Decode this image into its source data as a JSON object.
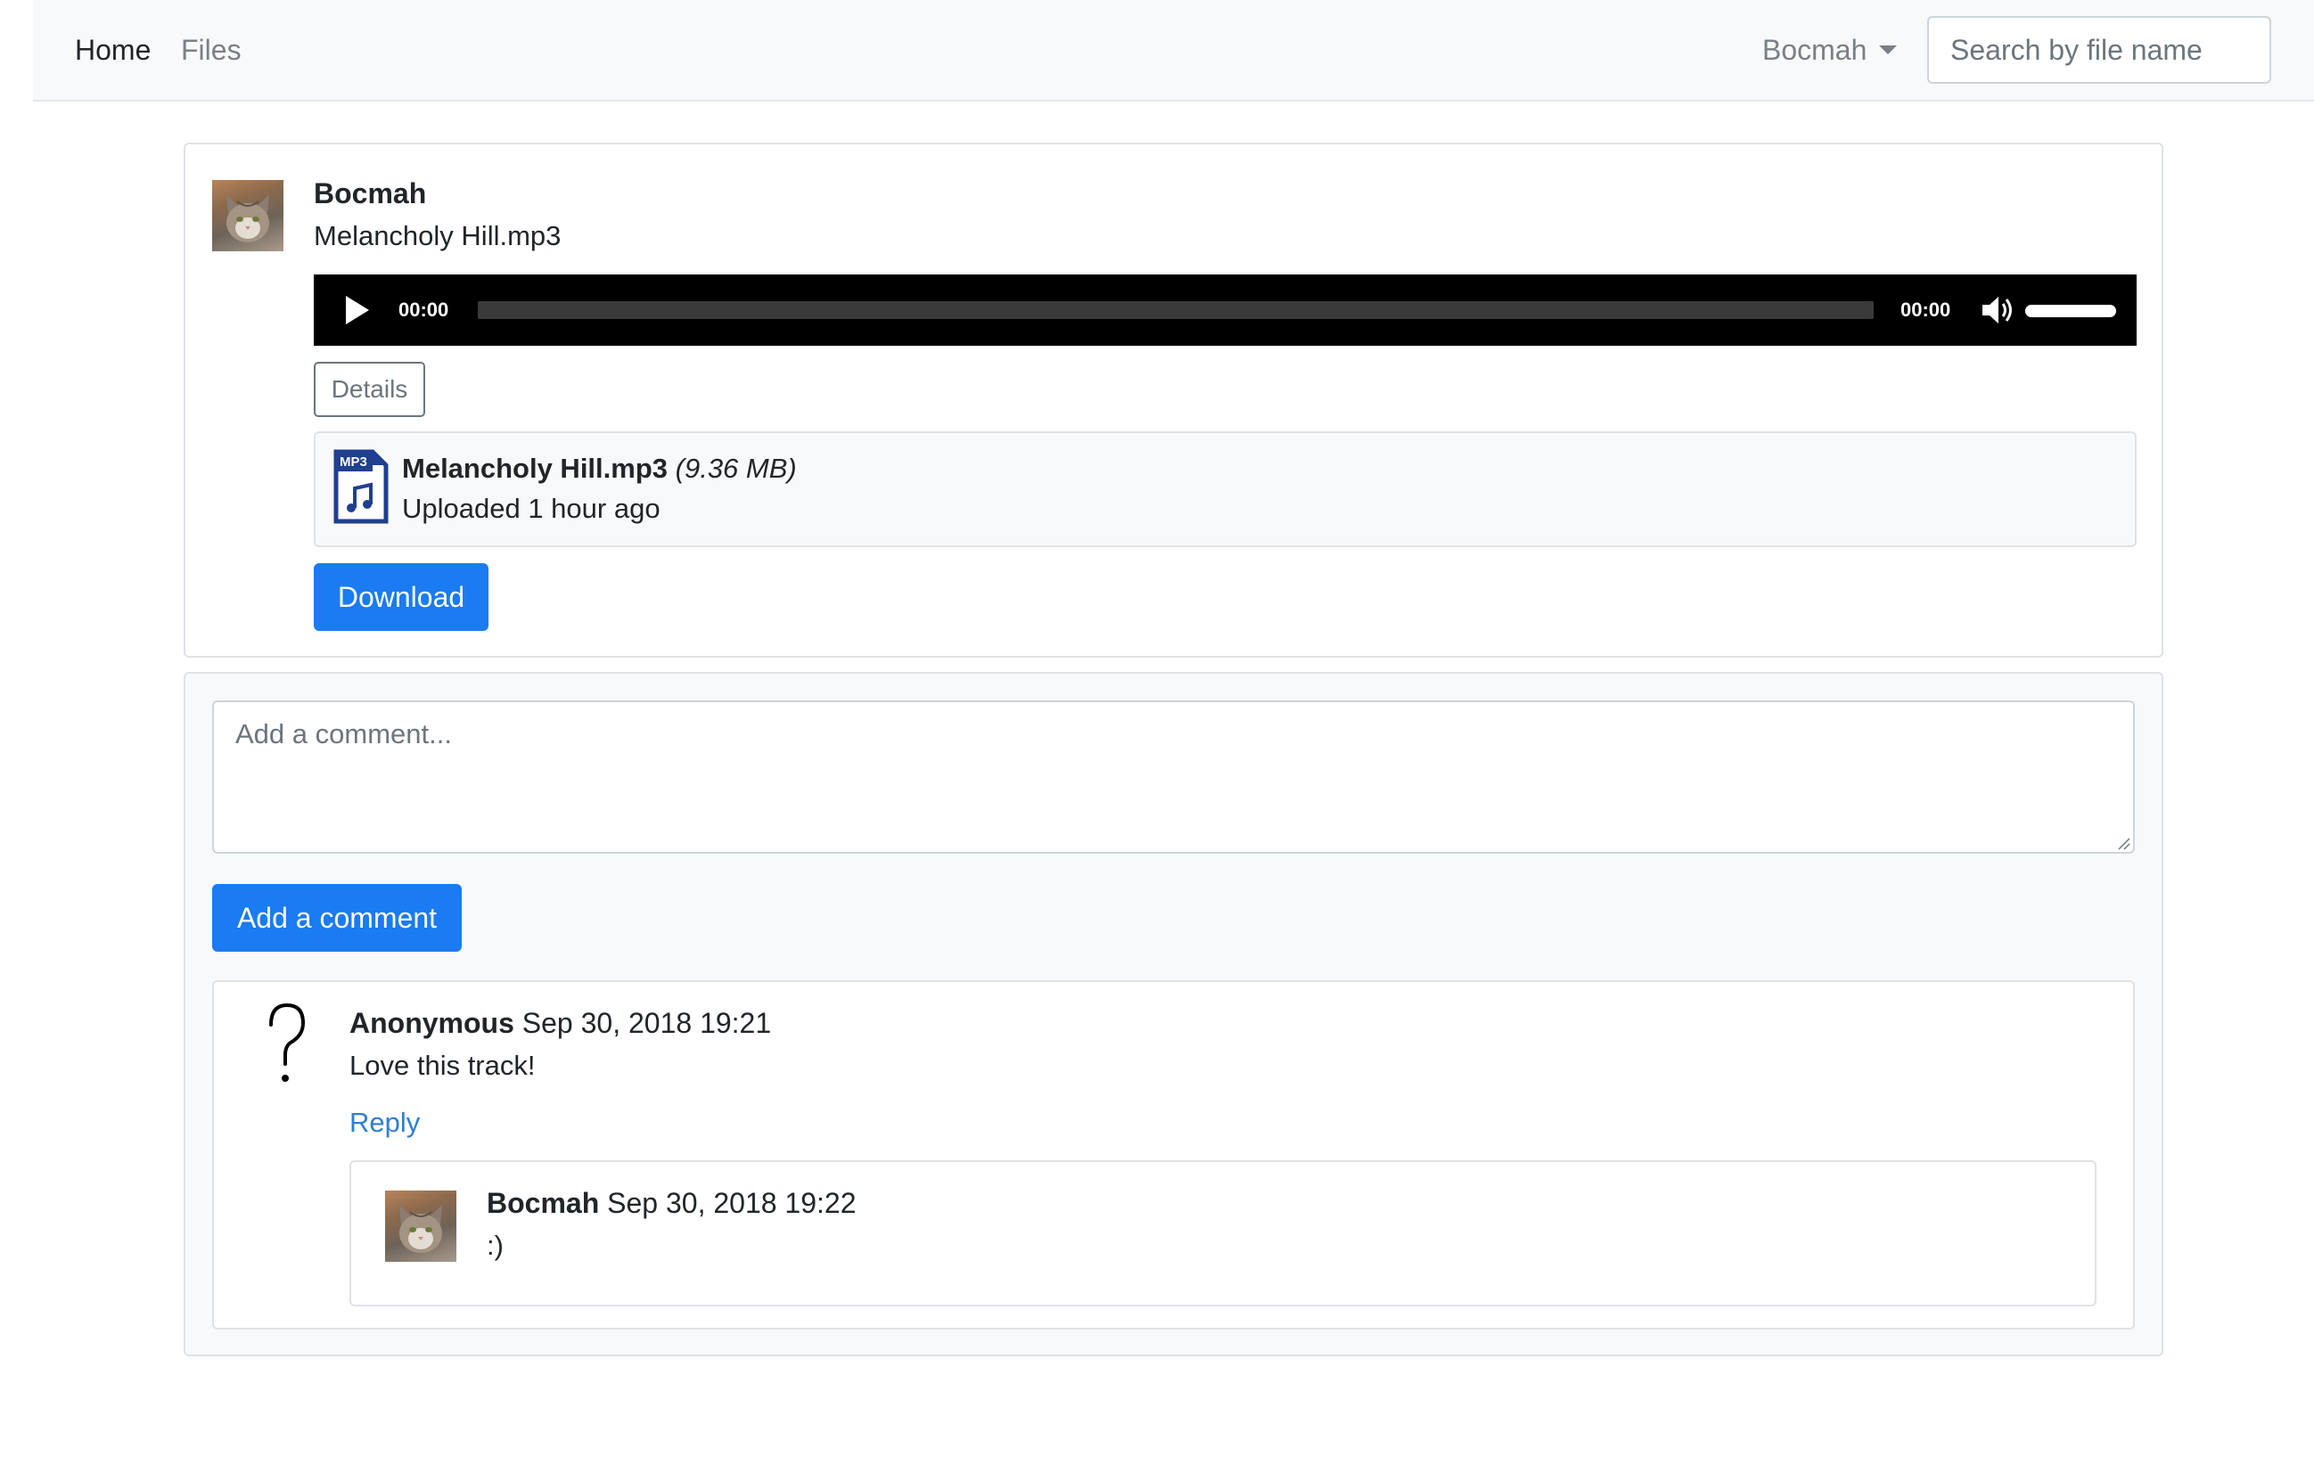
{
  "navbar": {
    "links": [
      {
        "label": "Home"
      },
      {
        "label": "Files"
      }
    ],
    "user_menu_label": "Bocmah",
    "search_placeholder": "Search by file name"
  },
  "file_post": {
    "owner": "Bocmah",
    "title": "Melancholy Hill.mp3",
    "player": {
      "current_time": "00:00",
      "duration": "00:00",
      "progress": 0,
      "volume": 1.0
    },
    "details_label": "Details",
    "file": {
      "icon": "mp3-file-icon",
      "icon_label": "MP3",
      "name": "Melancholy Hill.mp3",
      "size": "(9.36 MB)",
      "uploaded": "Uploaded 1 hour ago"
    },
    "download_label": "Download"
  },
  "comments": {
    "input_placeholder": "Add a comment...",
    "submit_label": "Add a comment",
    "items": [
      {
        "author": "Anonymous",
        "timestamp": "Sep 30, 2018 19:21",
        "text": "Love this track!",
        "reply_label": "Reply",
        "avatar_icon": "question-mark-icon",
        "replies": [
          {
            "author": "Bocmah",
            "timestamp": "Sep 30, 2018 19:22",
            "text": ":)"
          }
        ]
      }
    ]
  },
  "colors": {
    "primary": "#1a7bf2",
    "link": "#2f7fd2",
    "player_bg": "#000000",
    "mp3_icon": "#1f3f8f"
  }
}
